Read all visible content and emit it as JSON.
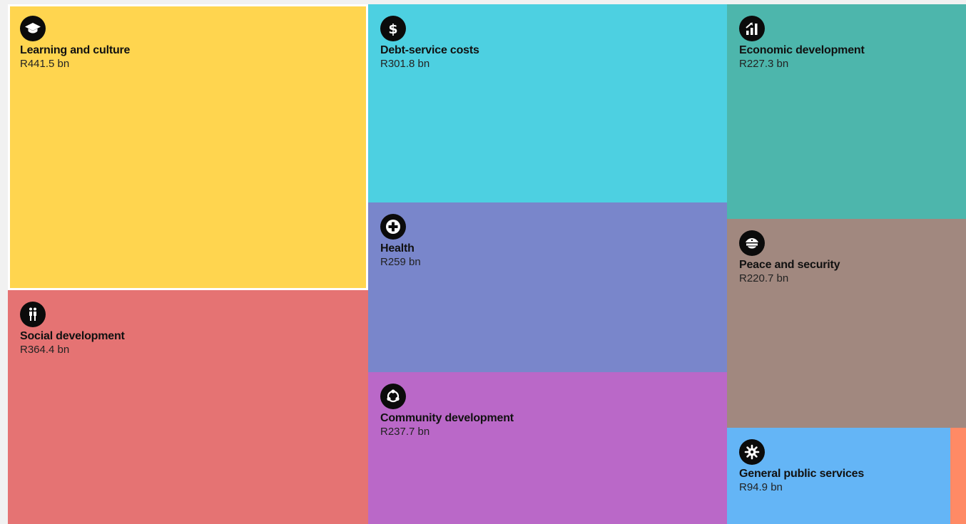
{
  "chart_data": {
    "type": "treemap",
    "unit": "bn",
    "items": [
      {
        "name": "Learning and culture",
        "value_label": "R441.5 bn",
        "value": 441.5,
        "icon": "graduation-cap-icon",
        "color": "#ffd54f",
        "selected": true
      },
      {
        "name": "Social development",
        "value_label": "R364.4 bn",
        "value": 364.4,
        "icon": "people-icon",
        "color": "#e57373"
      },
      {
        "name": "Debt-service costs",
        "value_label": "R301.8 bn",
        "value": 301.8,
        "icon": "dollar-icon",
        "color": "#4dd0e1"
      },
      {
        "name": "Health",
        "value_label": "R259 bn",
        "value": 259,
        "icon": "medical-cross-icon",
        "color": "#7986cb"
      },
      {
        "name": "Community development",
        "value_label": "R237.7 bn",
        "value": 237.7,
        "icon": "community-icon",
        "color": "#ba68c8"
      },
      {
        "name": "Economic development",
        "value_label": "R227.3 bn",
        "value": 227.3,
        "icon": "signal-bars-icon",
        "color": "#4db6ac"
      },
      {
        "name": "Peace and security",
        "value_label": "R220.7 bn",
        "value": 220.7,
        "icon": "police-cap-icon",
        "color": "#a1887f"
      },
      {
        "name": "General public services",
        "value_label": "R94.9 bn",
        "value": 94.9,
        "icon": "gear-icon",
        "color": "#64b5f6"
      },
      {
        "name": "",
        "value_label": "",
        "icon": "",
        "color": "#ff8a65"
      }
    ]
  }
}
